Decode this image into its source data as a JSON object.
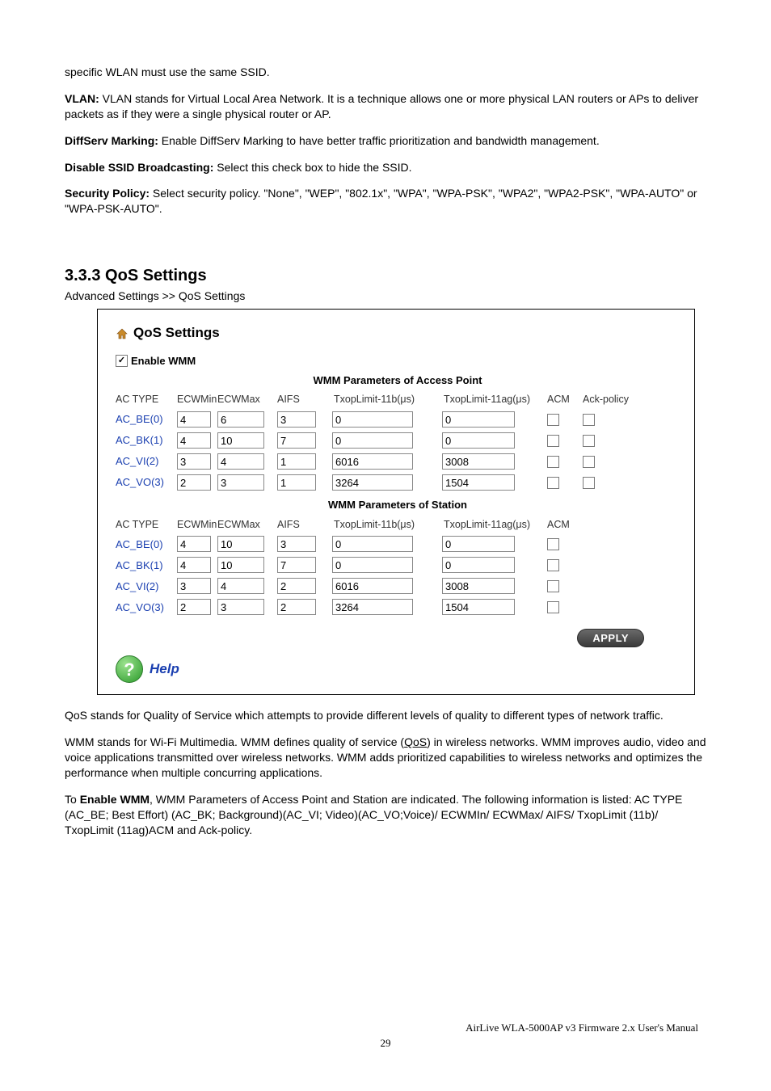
{
  "intro": {
    "line1": "specific WLAN must use the same SSID.",
    "vlan_label": "VLAN:",
    "vlan_text": " VLAN stands for Virtual Local Area Network. It is a technique allows one or more physical LAN routers or APs to deliver packets as if they were a single physical router or AP.",
    "diffserv_label": "DiffServ Marking:",
    "diffserv_text": " Enable DiffServ Marking to have better traffic prioritization and bandwidth management.",
    "disable_ssid_label": "Disable SSID Broadcasting:",
    "disable_ssid_text": " Select this check box to hide the SSID.",
    "security_label": "Security Policy:",
    "security_text": " Select security policy. \"None\", \"WEP\", \"802.1x\", \"WPA\", \"WPA-PSK\", \"WPA2\", \"WPA2-PSK\", \"WPA-AUTO\" or \"WPA-PSK-AUTO\"."
  },
  "section": {
    "heading": "3.3.3 QoS Settings",
    "breadcrumb": "Advanced Settings >> QoS Settings"
  },
  "panel": {
    "title": "QoS Settings",
    "enable_label": "Enable WMM",
    "enable_checked": "✓",
    "ap_caption": "WMM Parameters of Access Point",
    "sta_caption": "WMM Parameters of Station",
    "hdr": {
      "actype": "AC TYPE",
      "ecwmin": "ECWMin",
      "ecwmax": "ECWMax",
      "aifs": "AIFS",
      "tx11b": "TxopLimit-11b(μs)",
      "tx11ag": "TxopLimit-11ag(μs)",
      "acm": "ACM",
      "ack": "Ack-policy"
    },
    "ap_rows": [
      {
        "name": "AC_BE(0)",
        "ecwmin": "4",
        "ecwmax": "6",
        "aifs": "3",
        "tx11b": "0",
        "tx11ag": "0"
      },
      {
        "name": "AC_BK(1)",
        "ecwmin": "4",
        "ecwmax": "10",
        "aifs": "7",
        "tx11b": "0",
        "tx11ag": "0"
      },
      {
        "name": "AC_VI(2)",
        "ecwmin": "3",
        "ecwmax": "4",
        "aifs": "1",
        "tx11b": "6016",
        "tx11ag": "3008"
      },
      {
        "name": "AC_VO(3)",
        "ecwmin": "2",
        "ecwmax": "3",
        "aifs": "1",
        "tx11b": "3264",
        "tx11ag": "1504"
      }
    ],
    "sta_rows": [
      {
        "name": "AC_BE(0)",
        "ecwmin": "4",
        "ecwmax": "10",
        "aifs": "3",
        "tx11b": "0",
        "tx11ag": "0"
      },
      {
        "name": "AC_BK(1)",
        "ecwmin": "4",
        "ecwmax": "10",
        "aifs": "7",
        "tx11b": "0",
        "tx11ag": "0"
      },
      {
        "name": "AC_VI(2)",
        "ecwmin": "3",
        "ecwmax": "4",
        "aifs": "2",
        "tx11b": "6016",
        "tx11ag": "3008"
      },
      {
        "name": "AC_VO(3)",
        "ecwmin": "2",
        "ecwmax": "3",
        "aifs": "2",
        "tx11b": "3264",
        "tx11ag": "1504"
      }
    ],
    "apply": "APPLY",
    "help": "Help"
  },
  "post": {
    "p1": "QoS stands for Quality of Service which attempts to provide different levels of quality to different types of network traffic.",
    "p2a": "WMM stands for Wi-Fi Multimedia. WMM defines quality of service (",
    "p2link": "QoS",
    "p2b": ") in wireless networks. WMM improves audio, video and voice applications transmitted over wireless networks. WMM adds prioritized capabilities to wireless networks and optimizes the performance when multiple concurring applications.",
    "p3a": "To ",
    "p3bold": "Enable WMM",
    "p3b": ", WMM Parameters of Access Point and Station are indicated. The following information is listed: AC TYPE (AC_BE; Best Effort) (AC_BK; Background)(AC_VI; Video)(AC_VO;Voice)/ ECWMIn/ ECWMax/ AIFS/ TxopLimit (11b)/ TxopLimit (11ag)ACM and Ack-policy."
  },
  "footer": {
    "manual": "AirLive WLA-5000AP v3 Firmware 2.x User's Manual",
    "page": "29"
  }
}
